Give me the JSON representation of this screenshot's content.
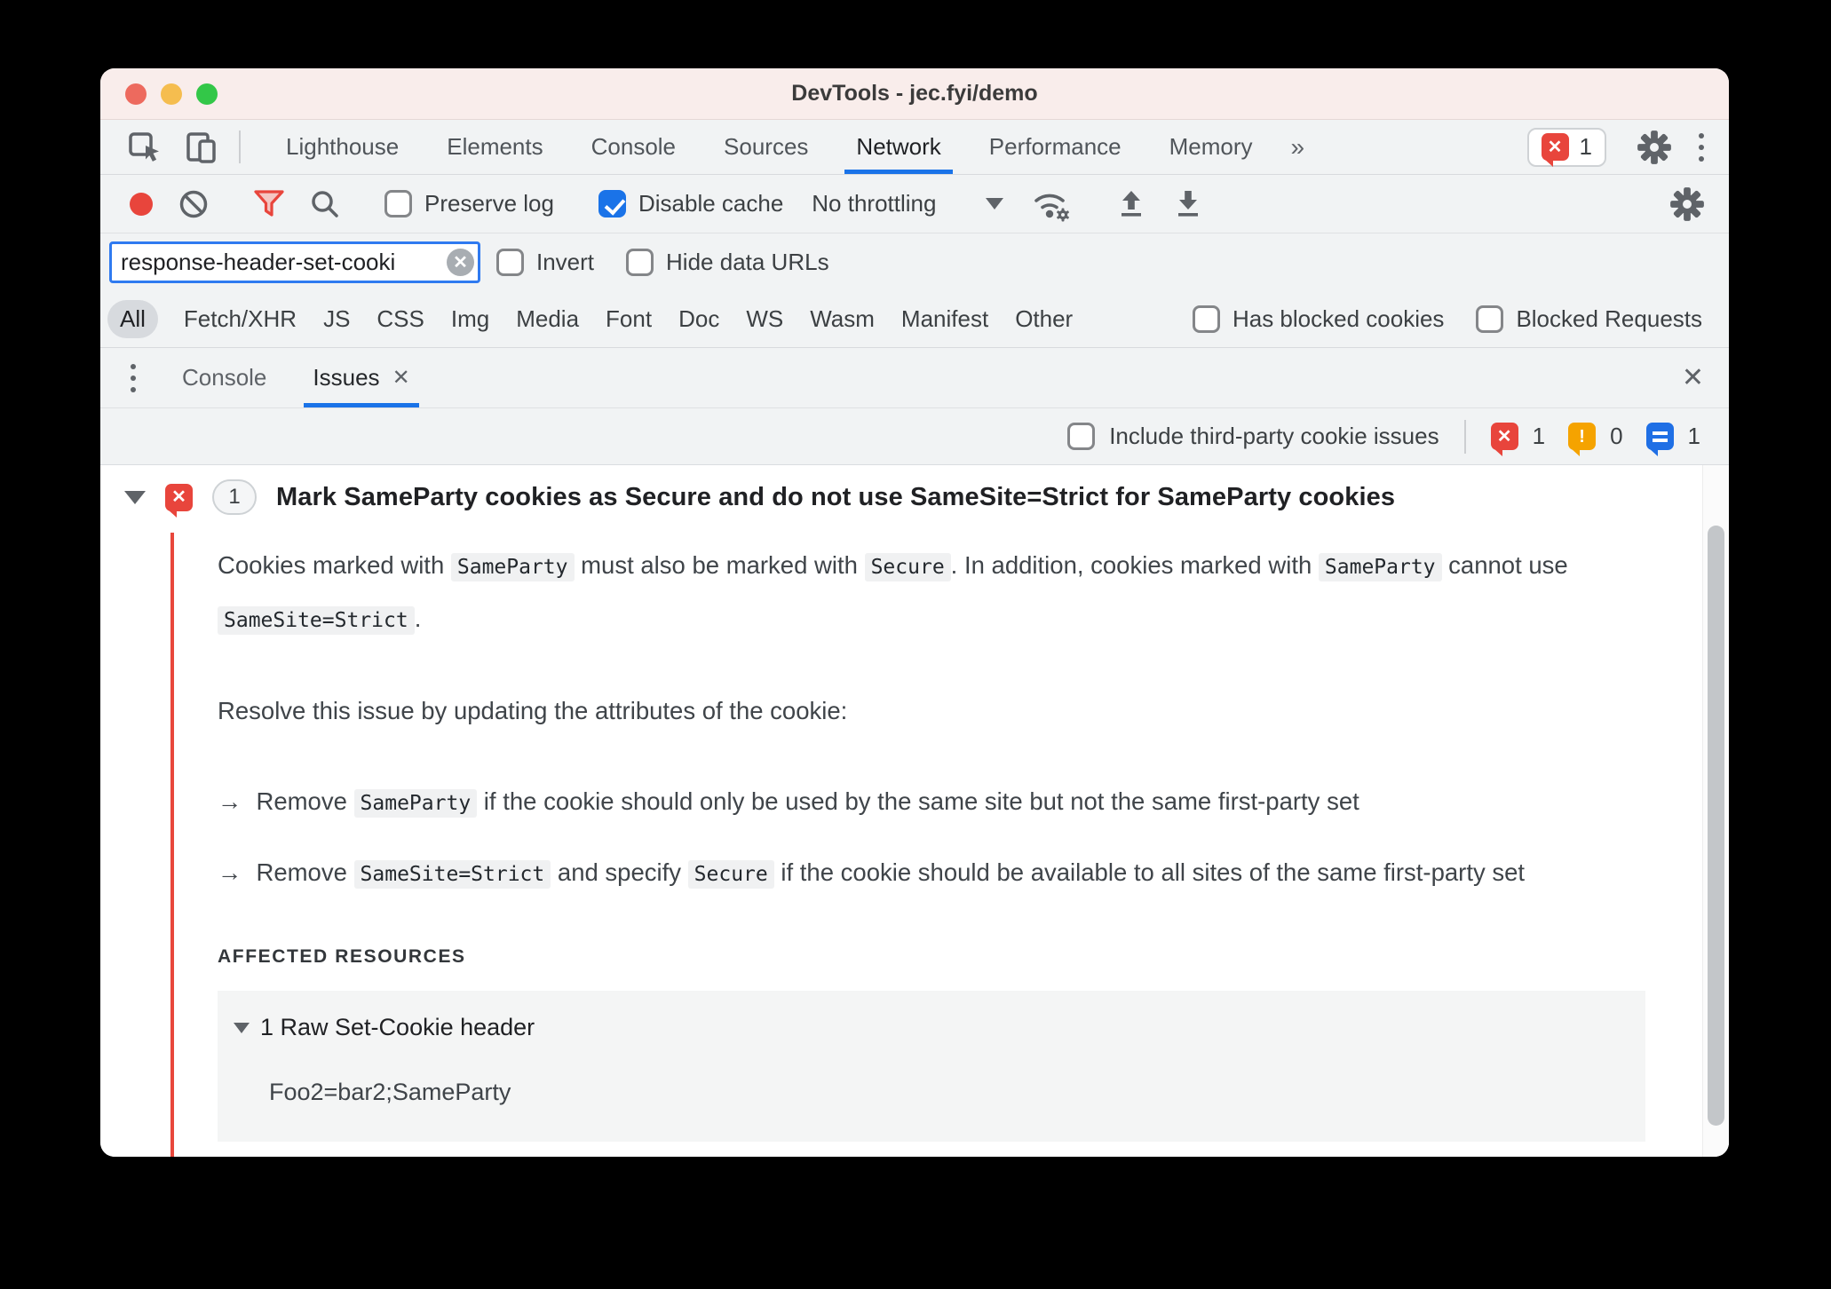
{
  "window": {
    "title": "DevTools - jec.fyi/demo"
  },
  "main_tabs": {
    "items": [
      {
        "label": "Lighthouse"
      },
      {
        "label": "Elements"
      },
      {
        "label": "Console"
      },
      {
        "label": "Sources"
      },
      {
        "label": "Network",
        "active": true
      },
      {
        "label": "Performance"
      },
      {
        "label": "Memory"
      }
    ],
    "error_count": "1"
  },
  "network_toolbar": {
    "preserve_log": "Preserve log",
    "disable_cache": "Disable cache",
    "throttling": "No throttling"
  },
  "filter_bar": {
    "value": "response-header-set-cooki",
    "invert": "Invert",
    "hide_data_urls": "Hide data URLs"
  },
  "type_filters": {
    "items": [
      "All",
      "Fetch/XHR",
      "JS",
      "CSS",
      "Img",
      "Media",
      "Font",
      "Doc",
      "WS",
      "Wasm",
      "Manifest",
      "Other"
    ],
    "selected": "All",
    "has_blocked_cookies": "Has blocked cookies",
    "blocked_requests": "Blocked Requests"
  },
  "drawer": {
    "tabs": [
      {
        "label": "Console"
      },
      {
        "label": "Issues",
        "active": true
      }
    ]
  },
  "issues_toolbar": {
    "include_third_party": "Include third-party cookie issues",
    "error_count": "1",
    "warning_count": "0",
    "info_count": "1"
  },
  "issue": {
    "count": "1",
    "title": "Mark SameParty cookies as Secure and do not use SameSite=Strict for SameParty cookies",
    "description": [
      {
        "type": "p",
        "segments": [
          {
            "t": "text",
            "v": "Cookies marked with "
          },
          {
            "t": "code",
            "v": "SameParty"
          },
          {
            "t": "text",
            "v": " must also be marked with "
          },
          {
            "t": "code",
            "v": "Secure"
          },
          {
            "t": "text",
            "v": ". In addition, cookies marked with "
          },
          {
            "t": "code",
            "v": "SameParty"
          },
          {
            "t": "text",
            "v": " cannot use "
          },
          {
            "t": "code",
            "v": "SameSite=Strict"
          },
          {
            "t": "text",
            "v": "."
          }
        ]
      },
      {
        "type": "p",
        "segments": [
          {
            "t": "text",
            "v": "Resolve this issue by updating the attributes of the cookie:"
          }
        ]
      },
      {
        "type": "li",
        "segments": [
          {
            "t": "text",
            "v": "Remove "
          },
          {
            "t": "code",
            "v": "SameParty"
          },
          {
            "t": "text",
            "v": " if the cookie should only be used by the same site but not the same first-party set"
          }
        ]
      },
      {
        "type": "li",
        "segments": [
          {
            "t": "text",
            "v": "Remove "
          },
          {
            "t": "code",
            "v": "SameSite=Strict"
          },
          {
            "t": "text",
            "v": " and specify "
          },
          {
            "t": "code",
            "v": "Secure"
          },
          {
            "t": "text",
            "v": " if the cookie should be available to all sites of the same first-party set"
          }
        ]
      }
    ],
    "affected_resources": {
      "label": "AFFECTED RESOURCES",
      "group": "1 Raw Set-Cookie header",
      "value": "Foo2=bar2;SameParty"
    }
  },
  "icons": {
    "overflow_chevron": "»",
    "tab_close": "✕",
    "drawer_close": "✕",
    "input_clear": "✕",
    "error_glyph": "✕",
    "warning_glyph": "!",
    "arrow_bullet": "→"
  },
  "colors": {
    "accent_blue": "#1a73e8",
    "error_red": "#e8453c",
    "warning_orange": "#f5a300",
    "info_blue": "#1f6fe5",
    "titlebar_pink": "#f9edeb",
    "toolbar_gray": "#f1f3f4"
  }
}
